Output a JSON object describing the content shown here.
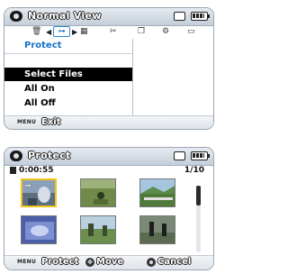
{
  "screen1": {
    "title": "Normal View",
    "menu_header": "Protect",
    "menu_items": [
      "Select Files",
      "All On",
      "All Off"
    ],
    "selected_index": 0,
    "footer": {
      "key": "MENU",
      "label": "Exit"
    },
    "icon_row": [
      "trash-icon",
      "protect-key-icon",
      "grid-icon",
      "scissors-icon",
      "copy-icon",
      "settings-gear-icon",
      "slideshow-icon"
    ]
  },
  "screen2": {
    "title": "Protect",
    "timecode": "0:00:55",
    "counter": "1/10",
    "selected_thumbnail": 0,
    "footer": {
      "menu_key": "MENU",
      "protect": "Protect",
      "move": "Move",
      "cancel": "Cancel"
    }
  },
  "colors": {
    "highlight": "#000000",
    "accent_blue": "#1574c8",
    "selection_yellow": "#f0c419"
  }
}
